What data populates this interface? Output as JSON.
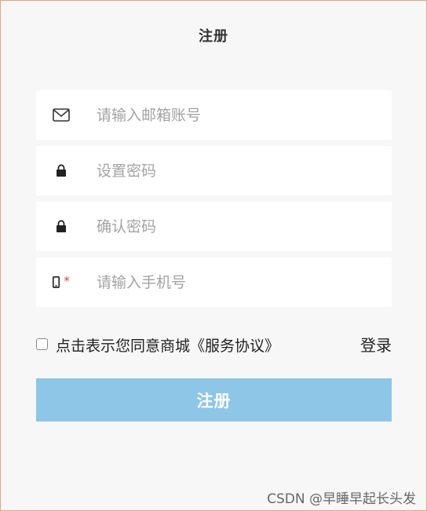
{
  "page": {
    "title": "注册"
  },
  "form": {
    "email": {
      "placeholder": "请输入邮箱账号",
      "value": ""
    },
    "password": {
      "placeholder": "设置密码",
      "value": ""
    },
    "confirm": {
      "placeholder": "确认密码",
      "value": ""
    },
    "phone": {
      "placeholder": "请输入手机号",
      "value": "",
      "required_mark": "*"
    }
  },
  "agreement": {
    "checked": false,
    "text": "点击表示您同意商城《服务协议》"
  },
  "login_link": "登录",
  "submit_label": "注册",
  "watermark": "CSDN @早睡早起长头发",
  "icons": {
    "email": "mail-icon",
    "password": "lock-icon",
    "confirm": "lock-icon",
    "phone": "phone-icon"
  },
  "colors": {
    "submit_bg": "#8ec6e8",
    "required": "#e23b3b",
    "placeholder": "#a3a3a3"
  }
}
